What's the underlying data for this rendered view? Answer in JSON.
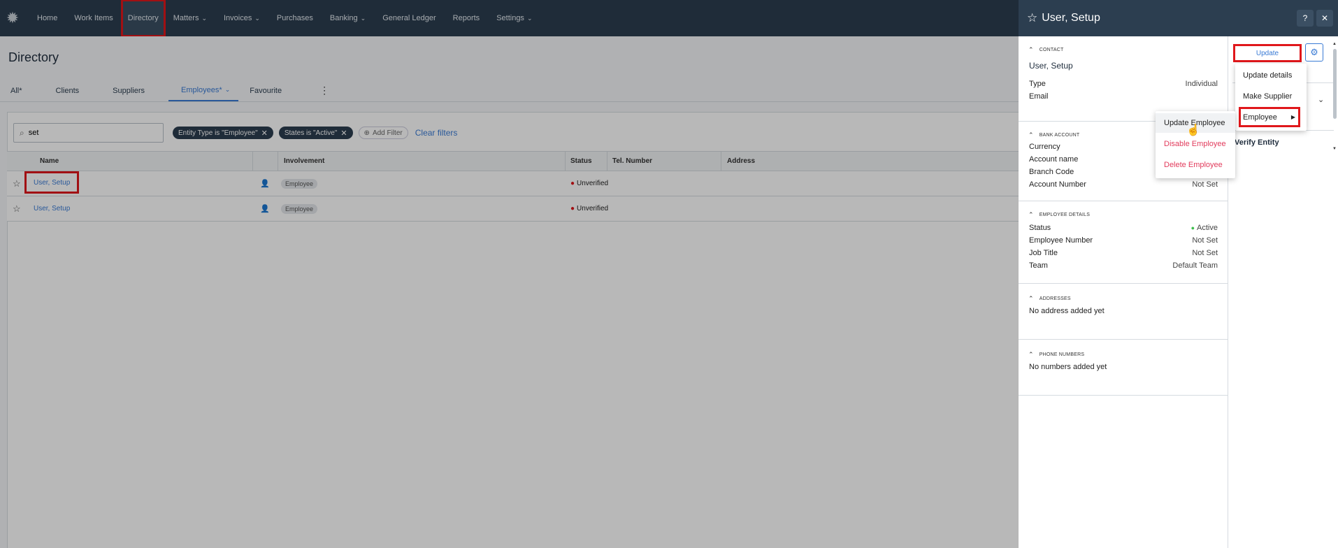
{
  "nav": {
    "items": [
      {
        "label": "Home",
        "chev": false
      },
      {
        "label": "Work Items",
        "chev": false
      },
      {
        "label": "Directory",
        "chev": false
      },
      {
        "label": "Matters",
        "chev": true
      },
      {
        "label": "Invoices",
        "chev": true
      },
      {
        "label": "Purchases",
        "chev": false
      },
      {
        "label": "Banking",
        "chev": true
      },
      {
        "label": "General Ledger",
        "chev": false
      },
      {
        "label": "Reports",
        "chev": false
      },
      {
        "label": "Settings",
        "chev": true
      }
    ]
  },
  "page": {
    "title": "Directory"
  },
  "tabs": [
    "All*",
    "Clients",
    "Suppliers",
    "Employees*",
    "Favourite"
  ],
  "filters": {
    "search_value": "set",
    "chips": [
      "Entity Type is \"Employee\"",
      "States is \"Active\""
    ],
    "add_filter": "Add Filter",
    "clear": "Clear filters"
  },
  "table": {
    "columns": [
      "Name",
      "",
      "Involvement",
      "Status",
      "Tel. Number",
      "Address"
    ],
    "rows": [
      {
        "name": "User, Setup",
        "involvement": "Employee",
        "status": "Unverified"
      },
      {
        "name": "User, Setup",
        "involvement": "Employee",
        "status": "Unverified"
      }
    ]
  },
  "panel": {
    "title": "User, Setup",
    "help": "?",
    "close": "✕",
    "contact": {
      "section": "CONTACT",
      "name": "User, Setup",
      "type_label": "Type",
      "type_value": "Individual",
      "email_label": "Email"
    },
    "bank": {
      "section": "BANK ACCOUNT",
      "currency": "Currency",
      "account_name": "Account name",
      "branch_code": "Branch Code",
      "account_number": "Account Number",
      "account_number_value": "Not Set"
    },
    "employee": {
      "section": "EMPLOYEE DETAILS",
      "status_label": "Status",
      "status_value": "Active",
      "number_label": "Employee Number",
      "number_value": "Not Set",
      "job_label": "Job Title",
      "job_value": "Not Set",
      "team_label": "Team",
      "team_value": "Default Team"
    },
    "addresses": {
      "section": "ADDRESSES",
      "empty": "No address added yet"
    },
    "phones": {
      "section": "PHONE NUMBERS",
      "empty": "No numbers added yet"
    },
    "update_label": "Update",
    "verify_label": "Verify Entity"
  },
  "update_menu": [
    "Update details",
    "Make Supplier",
    "Employee"
  ],
  "employee_menu": [
    "Update Employee",
    "Disable Employee",
    "Delete Employee"
  ],
  "colors": {
    "nav_bg": "#2c3e50",
    "accent": "#3a7bd5",
    "danger": "#e23b5c",
    "highlight": "#e0171b"
  }
}
